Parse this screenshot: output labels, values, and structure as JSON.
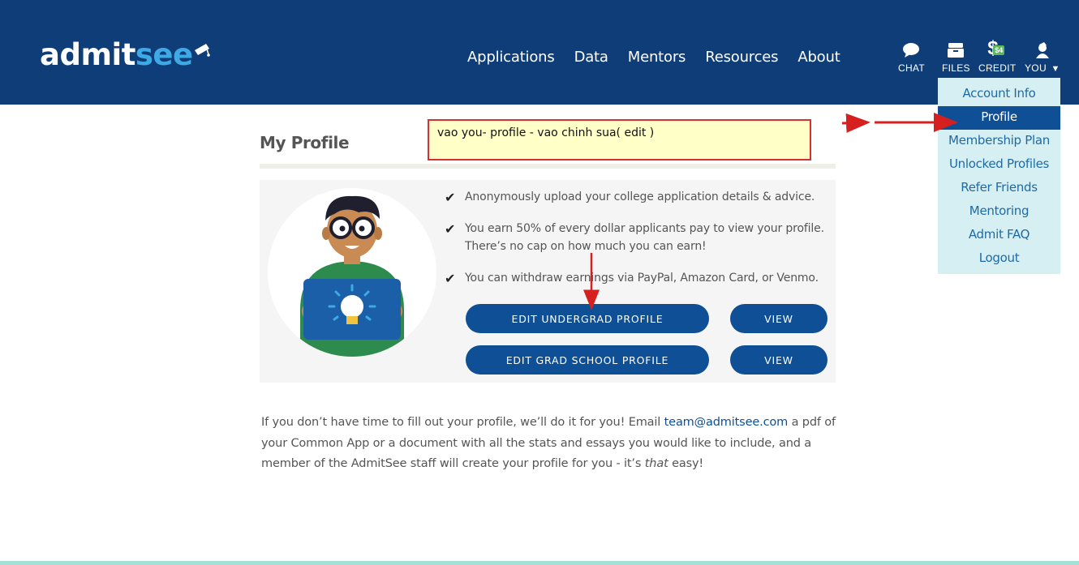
{
  "header": {
    "logo_part1": "admit",
    "logo_part2": "see",
    "nav": [
      "Applications",
      "Data",
      "Mentors",
      "Resources",
      "About"
    ],
    "tools": {
      "chat": "CHAT",
      "files": "FILES",
      "credit": "CREDIT",
      "credit_badge": "$4",
      "you": "YOU"
    }
  },
  "dropdown": {
    "items": [
      "Account Info",
      "Profile",
      "Membership Plan",
      "Unlocked Profiles",
      "Refer Friends",
      "Mentoring",
      "Admit FAQ",
      "Logout"
    ],
    "active": "Profile"
  },
  "page": {
    "title": "My Profile",
    "bullets": [
      "Anonymously upload your college application details & advice.",
      "You earn 50% of every dollar applicants pay to view your profile. There’s no cap on how much you can earn!",
      "You can withdraw earnings via PayPal, Amazon Card, or Venmo."
    ],
    "buttons": {
      "edit_undergrad": "EDIT UNDERGRAD PROFILE",
      "view_undergrad": "VIEW",
      "edit_grad": "EDIT GRAD SCHOOL PROFILE",
      "view_grad": "VIEW"
    },
    "note": {
      "pre": "If you don’t have time to fill out your profile, we’ll do it for you! Email ",
      "email": "team@admitsee.com",
      "mid": " a pdf of your Common App or a document with all the stats and essays you would like to include, and a member of the AdmitSee staff will create your profile for you - it’s ",
      "em": "that",
      "post": " easy!"
    }
  },
  "annotation": {
    "text": "vao you- profile - vao chinh sua( edit )"
  },
  "colors": {
    "header_bg": "#0e3d78",
    "accent_blue": "#0e4f95",
    "logo_see": "#3fa9e6",
    "dropdown_bg": "#d6eff2",
    "annotation_bg": "#ffffc8",
    "annotation_border": "#d63030"
  },
  "icons": [
    "chat-icon",
    "files-icon",
    "credit-icon",
    "user-icon",
    "caret-down-icon",
    "check-icon",
    "graduation-cap-icon",
    "lightbulb-icon"
  ]
}
